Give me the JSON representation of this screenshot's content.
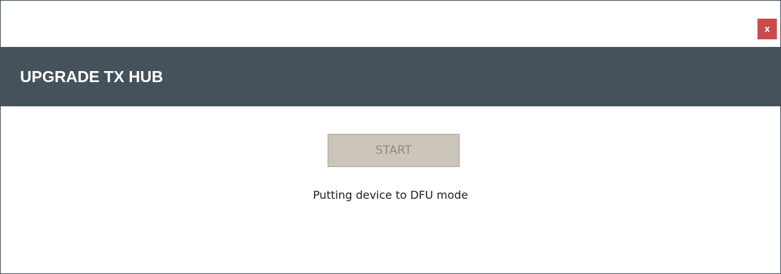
{
  "window": {
    "close_label": "x"
  },
  "header": {
    "title": "UPGRADE TX HUB"
  },
  "main": {
    "start_label": "START",
    "status": "Putting device to DFU mode"
  },
  "colors": {
    "header_bg": "#44525c",
    "close_bg": "#c94b4e",
    "button_disabled_bg": "#ccc5ba",
    "button_disabled_text": "#8e8a84"
  }
}
